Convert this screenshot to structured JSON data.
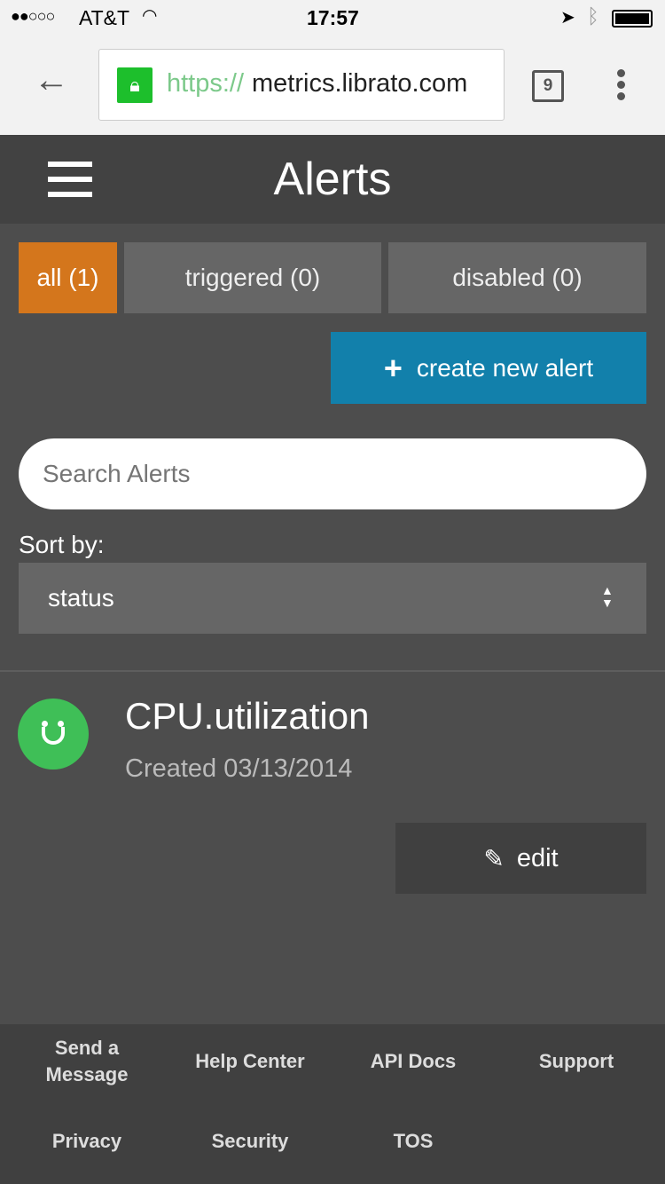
{
  "status_bar": {
    "carrier": "AT&T",
    "time": "17:57"
  },
  "browser": {
    "url_scheme": "https://",
    "url_host": "metrics.librato.com",
    "tab_count": "9"
  },
  "header": {
    "title": "Alerts"
  },
  "tabs": [
    {
      "label": "all (1)",
      "active": true
    },
    {
      "label": "triggered (0)"
    },
    {
      "label": "disabled (0)"
    }
  ],
  "create_button": {
    "label": "create new alert"
  },
  "search": {
    "placeholder": "Search Alerts",
    "value": ""
  },
  "sort": {
    "label": "Sort by:",
    "selected": "status"
  },
  "alerts": [
    {
      "name": "CPU.utilization",
      "created": "Created 03/13/2014",
      "status": "ok",
      "edit_label": "edit"
    }
  ],
  "footer": {
    "links": [
      "Send a Message",
      "Help Center",
      "API Docs",
      "Support",
      "Privacy",
      "Security",
      "TOS"
    ]
  },
  "colors": {
    "active_tab": "#d4761c",
    "create": "#1280ab",
    "ok": "#3fbf57",
    "lock": "#1dbf2c"
  }
}
